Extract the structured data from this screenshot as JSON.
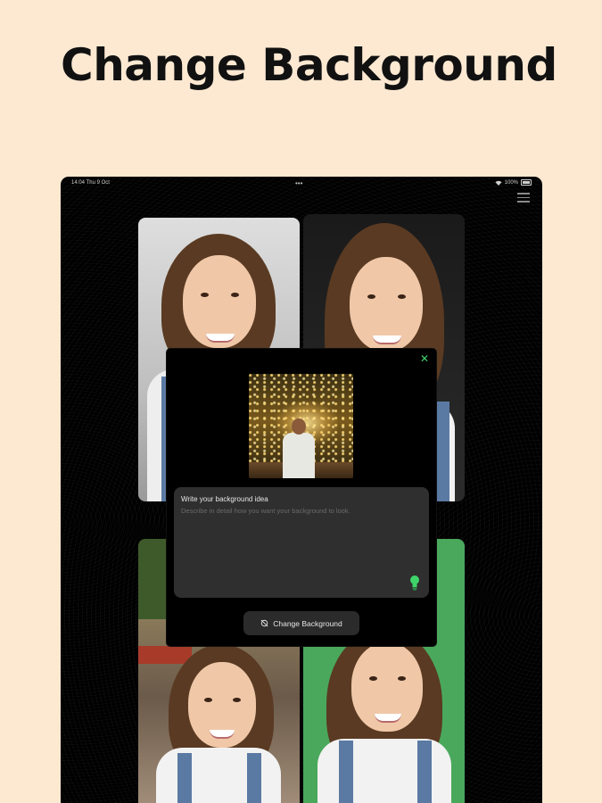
{
  "promo": {
    "title": "Change Background"
  },
  "status_bar": {
    "time": "14:04  Thu 9 Oct",
    "dots": "•••",
    "battery": "100%"
  },
  "modal": {
    "prompt_label": "Write your background idea",
    "prompt_placeholder": "Describe in detail how you want your background to look.",
    "prompt_value": "",
    "change_button_label": "Change Background"
  },
  "icons": {
    "close": "close-icon",
    "bulb": "lightbulb-icon",
    "menu": "menu-icon",
    "wifi": "wifi-icon",
    "battery": "battery-icon",
    "change": "refresh-icon"
  },
  "colors": {
    "page_background": "#fde9d2",
    "device_background": "#000000",
    "accent_green": "#3fd46a",
    "prompt_box": "#2f2f2f",
    "green_screen_tile": "#4aa85c"
  }
}
